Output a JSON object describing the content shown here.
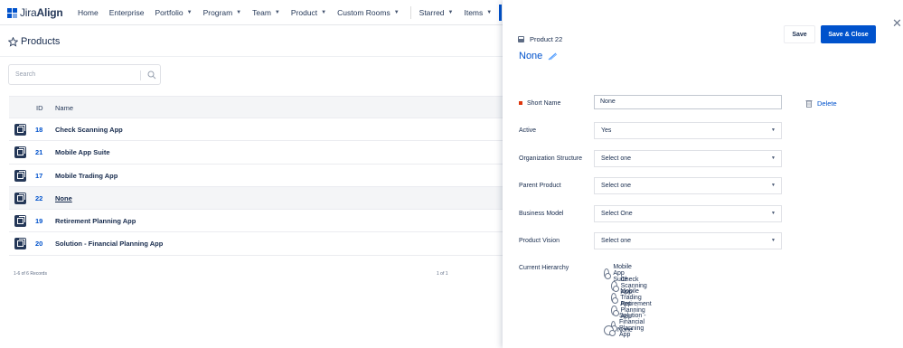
{
  "app": {
    "logo_name": "Jira",
    "logo_suffix": "Align",
    "brand_color": "#0052cc"
  },
  "nav": {
    "items": [
      {
        "label": "Home",
        "dropdown": false
      },
      {
        "label": "Enterprise",
        "dropdown": false
      },
      {
        "label": "Portfolio",
        "dropdown": true
      },
      {
        "label": "Program",
        "dropdown": true
      },
      {
        "label": "Team",
        "dropdown": true
      },
      {
        "label": "Product",
        "dropdown": true
      },
      {
        "label": "Custom Rooms",
        "dropdown": true
      }
    ],
    "items2": [
      {
        "label": "Starred",
        "dropdown": true
      },
      {
        "label": "Items",
        "dropdown": true
      }
    ]
  },
  "page": {
    "title": "Products"
  },
  "search": {
    "placeholder": "Search"
  },
  "table": {
    "columns": [
      "ID",
      "Name"
    ],
    "rows": [
      {
        "id": "18",
        "name": "Check Scanning App",
        "selected": false
      },
      {
        "id": "21",
        "name": "Mobile App Suite",
        "selected": false
      },
      {
        "id": "17",
        "name": "Mobile Trading App",
        "selected": false
      },
      {
        "id": "22",
        "name": "None",
        "selected": true
      },
      {
        "id": "19",
        "name": "Retirement Planning App",
        "selected": false
      },
      {
        "id": "20",
        "name": "Solution - Financial Planning App",
        "selected": false
      }
    ],
    "records_text": "1-6 of 6 Records",
    "pager_text": "1 of 1"
  },
  "panel": {
    "breadcrumb": "Product 22",
    "title": "None",
    "save_label": "Save",
    "save_close_label": "Save & Close",
    "close_symbol": "✕",
    "delete_label": "Delete",
    "fields": {
      "short_name": {
        "label": "Short Name",
        "value": "None"
      },
      "active": {
        "label": "Active",
        "value": "Yes"
      },
      "org_structure": {
        "label": "Organization Structure",
        "value": "Select one"
      },
      "parent_product": {
        "label": "Parent Product",
        "value": "Select one"
      },
      "business_model": {
        "label": "Business Model",
        "value": "Select One"
      },
      "product_vision": {
        "label": "Product Vision",
        "value": "Select one"
      }
    },
    "hierarchy_label": "Current Hierarchy",
    "hierarchy": [
      {
        "label": "Mobile App Suite",
        "level": 0
      },
      {
        "label": "Check Scanning App",
        "level": 1
      },
      {
        "label": "Mobile Trading App",
        "level": 1
      },
      {
        "label": "Retirement Planning App",
        "level": 1
      },
      {
        "label": "Solution - Financial Planning App",
        "level": 1
      },
      {
        "label": "None",
        "level": 0
      }
    ]
  }
}
